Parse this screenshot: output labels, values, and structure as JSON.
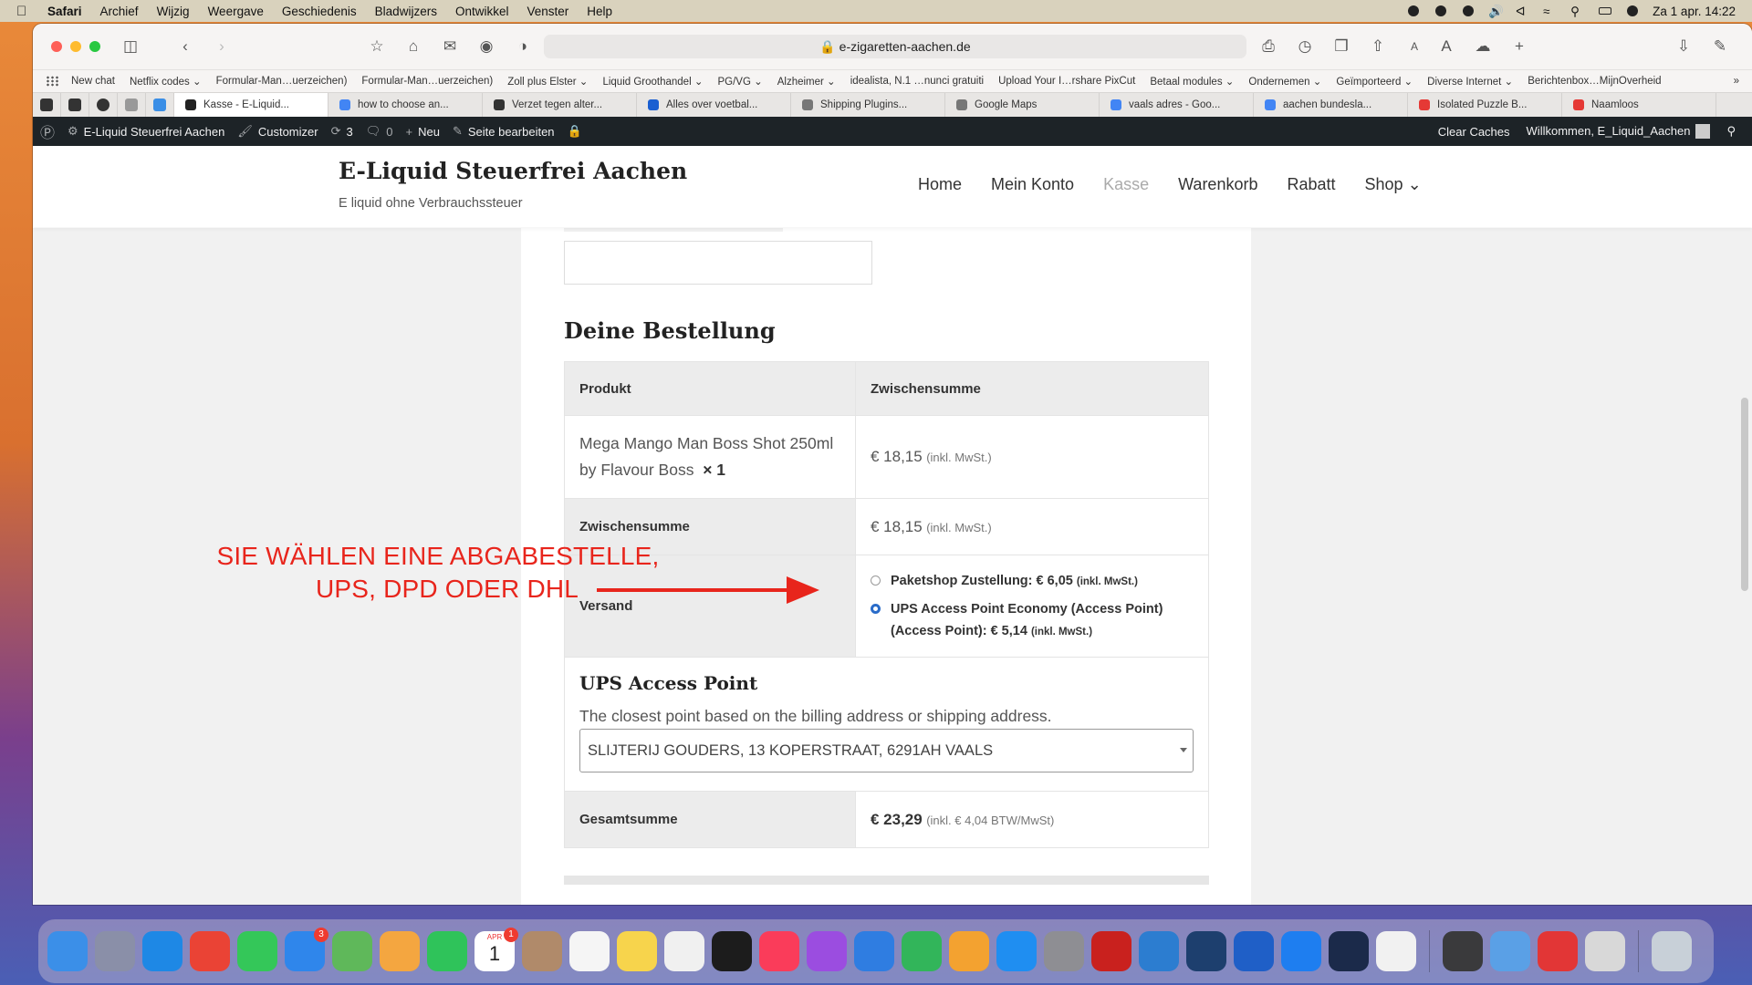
{
  "menubar": {
    "app": "Safari",
    "items": [
      "Archief",
      "Wijzig",
      "Weergave",
      "Geschiedenis",
      "Bladwijzers",
      "Ontwikkel",
      "Venster",
      "Help"
    ],
    "clock": "Za 1 apr.  14:22"
  },
  "browser": {
    "url": "e-zigaretten-aachen.de",
    "bookmarks": [
      "New chat",
      "Netflix codes ⌄",
      "Formular-Man…uerzeichen)",
      "Formular-Man…uerzeichen)",
      "Zoll plus Elster ⌄",
      "Liquid Groothandel ⌄",
      "PG/VG ⌄",
      "Alzheimer ⌄",
      "idealista, N.1 …nunci gratuiti",
      "Upload Your I…rshare PixCut",
      "Betaal modules ⌄",
      "Ondernemen ⌄",
      "Geïmporteerd ⌄",
      "Diverse Internet ⌄",
      "Berichtenbox…MijnOverheid"
    ],
    "tabs": [
      {
        "label": "Kasse - E-Liquid...",
        "color": "#222222",
        "active": true
      },
      {
        "label": "how to choose an...",
        "color": "#4285f4"
      },
      {
        "label": "Verzet tegen alter...",
        "color": "#333333"
      },
      {
        "label": "Alles over voetbal...",
        "color": "#1a5fd1"
      },
      {
        "label": "Shipping Plugins...",
        "color": "#777777"
      },
      {
        "label": "Google Maps",
        "color": "#777777"
      },
      {
        "label": "vaals adres - Goo...",
        "color": "#4285f4"
      },
      {
        "label": "aachen bundesla...",
        "color": "#4285f4"
      },
      {
        "label": "Isolated Puzzle B...",
        "color": "#e53935"
      },
      {
        "label": "Naamloos",
        "color": "#e53935"
      }
    ]
  },
  "adminbar": {
    "site": "E-Liquid Steuerfrei Aachen",
    "customizer": "Customizer",
    "updates": "3",
    "comments": "0",
    "new": "Neu",
    "edit": "Seite bearbeiten",
    "clear_caches": "Clear Caches",
    "welcome": "Willkommen, E_Liquid_Aachen"
  },
  "site": {
    "title": "E-Liquid Steuerfrei Aachen",
    "tagline": "E liquid ohne Verbrauchssteuer",
    "nav": [
      "Home",
      "Mein Konto",
      "Kasse",
      "Warenkorb",
      "Rabatt",
      "Shop ⌄"
    ]
  },
  "order": {
    "title": "Deine Bestellung",
    "col_product": "Produkt",
    "col_subtotal": "Zwischensumme",
    "product_name": "Mega Mango Man Boss Shot 250ml by Flavour Boss",
    "product_qty": "× 1",
    "product_price": "€ 18,15",
    "incl_vat": "(inkl. MwSt.)",
    "subtotal_label": "Zwischensumme",
    "subtotal_price": "€ 18,15",
    "shipping_label": "Versand",
    "shipping_options": [
      {
        "label": "Paketshop Zustellung: € 6,05",
        "suffix": "(inkl. MwSt.)",
        "selected": false
      },
      {
        "label": "UPS Access Point Economy (Access Point) (Access Point): € 5,14",
        "suffix": "(inkl. MwSt.)",
        "selected": true
      }
    ],
    "ups_title": "UPS Access Point",
    "ups_desc": "The closest point based on the billing address or shipping address.",
    "ups_selected": "SLIJTERIJ GOUDERS, 13 KOPERSTRAAT, 6291AH VAALS",
    "total_label": "Gesamtsumme",
    "total_price": "€ 23,29",
    "total_vat": "(inkl. € 4,04 BTW/MwSt)"
  },
  "annotation": {
    "line1": "SIE WÄHLEN EINE ABGABESTELLE,",
    "line2": "UPS, DPD ODER DHL",
    "color": "#e8251c"
  },
  "dock": {
    "apps": [
      {
        "name": "finder-icon",
        "color": "#3b8fe8"
      },
      {
        "name": "launchpad-icon",
        "color": "#8a8fa8"
      },
      {
        "name": "safari-icon",
        "color": "#1e88e5"
      },
      {
        "name": "chrome-icon",
        "color": "#ea4335"
      },
      {
        "name": "messages-icon",
        "color": "#34c759"
      },
      {
        "name": "mail-icon",
        "color": "#2f86eb",
        "badge": "3"
      },
      {
        "name": "maps-icon",
        "color": "#5fb85a"
      },
      {
        "name": "photos-icon",
        "color": "#f4a640"
      },
      {
        "name": "facetime-icon",
        "color": "#2fc35a"
      },
      {
        "name": "calendar-icon",
        "color": "#ffffff",
        "text": "1",
        "badge": "1"
      },
      {
        "name": "contacts-icon",
        "color": "#b08a6a"
      },
      {
        "name": "reminders-icon",
        "color": "#f5f5f5"
      },
      {
        "name": "notes-icon",
        "color": "#f7d44c"
      },
      {
        "name": "freeform-icon",
        "color": "#f0f0f0"
      },
      {
        "name": "tv-icon",
        "color": "#1c1c1c"
      },
      {
        "name": "music-icon",
        "color": "#fa3c5a"
      },
      {
        "name": "podcasts-icon",
        "color": "#9b4de0"
      },
      {
        "name": "keynote-icon",
        "color": "#2f7de1"
      },
      {
        "name": "numbers-icon",
        "color": "#32b55a"
      },
      {
        "name": "pages-icon",
        "color": "#f3a230"
      },
      {
        "name": "app-store-icon",
        "color": "#1f8ef1"
      },
      {
        "name": "system-settings-icon",
        "color": "#8e8e93"
      },
      {
        "name": "filezilla-icon",
        "color": "#c9211e"
      },
      {
        "name": "cyberduck-icon",
        "color": "#2c7dd0"
      },
      {
        "name": "proxyman-icon",
        "color": "#1d3f6e"
      },
      {
        "name": "1password-icon",
        "color": "#1f5fc7"
      },
      {
        "name": "archive-icon",
        "color": "#1e7ef0"
      },
      {
        "name": "code-editor-icon",
        "color": "#1b2a4a"
      },
      {
        "name": "1password-7-icon",
        "color": "#f1f1f1"
      },
      {
        "name": "keychain-icon",
        "color": "#3a3a3c"
      },
      {
        "name": "screens-icon",
        "color": "#5aa0e6"
      },
      {
        "name": "pdf-app-icon",
        "color": "#e23636"
      },
      {
        "name": "scanner-icon",
        "color": "#d8d8d8"
      },
      {
        "name": "trash-icon",
        "color": "#c8d0d8"
      }
    ]
  }
}
